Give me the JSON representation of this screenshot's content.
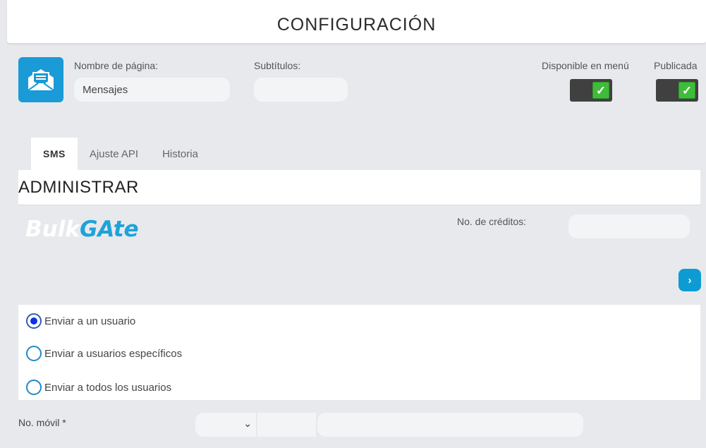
{
  "header": {
    "title": "CONFIGURACIÓN"
  },
  "page_name": {
    "label": "Nombre de página:",
    "value": "Mensajes"
  },
  "subtitles": {
    "label": "Subtítulos:",
    "value": ""
  },
  "toggles": {
    "menu_label": "Disponible en menú",
    "published_label": "Publicada",
    "menu_checked": true,
    "published_checked": true,
    "check_glyph": "✓"
  },
  "tabs": [
    {
      "label": "SMS",
      "active": true
    },
    {
      "label": "Ajuste API",
      "active": false
    },
    {
      "label": "Historia",
      "active": false
    }
  ],
  "admin": {
    "title": "ADMINISTRAR"
  },
  "logo": {
    "part1": "Bulk",
    "part2": "GAte"
  },
  "credits": {
    "label": "No. de créditos:",
    "value": ""
  },
  "next_button": {
    "glyph": "›"
  },
  "radio_options": [
    {
      "label": "Enviar a un usuario",
      "checked": true
    },
    {
      "label": "Enviar a usuarios específicos",
      "checked": false
    },
    {
      "label": "Enviar a todos los usuarios",
      "checked": false
    }
  ],
  "phone": {
    "label": "No. móvil *",
    "chevron": "⌄"
  },
  "colors": {
    "accent": "#1a9ad6",
    "check_green": "#3fbc3a",
    "toggle_dark": "#404040",
    "background": "#e8e9ed"
  },
  "icons": {
    "app": "envelope-open-icon"
  }
}
